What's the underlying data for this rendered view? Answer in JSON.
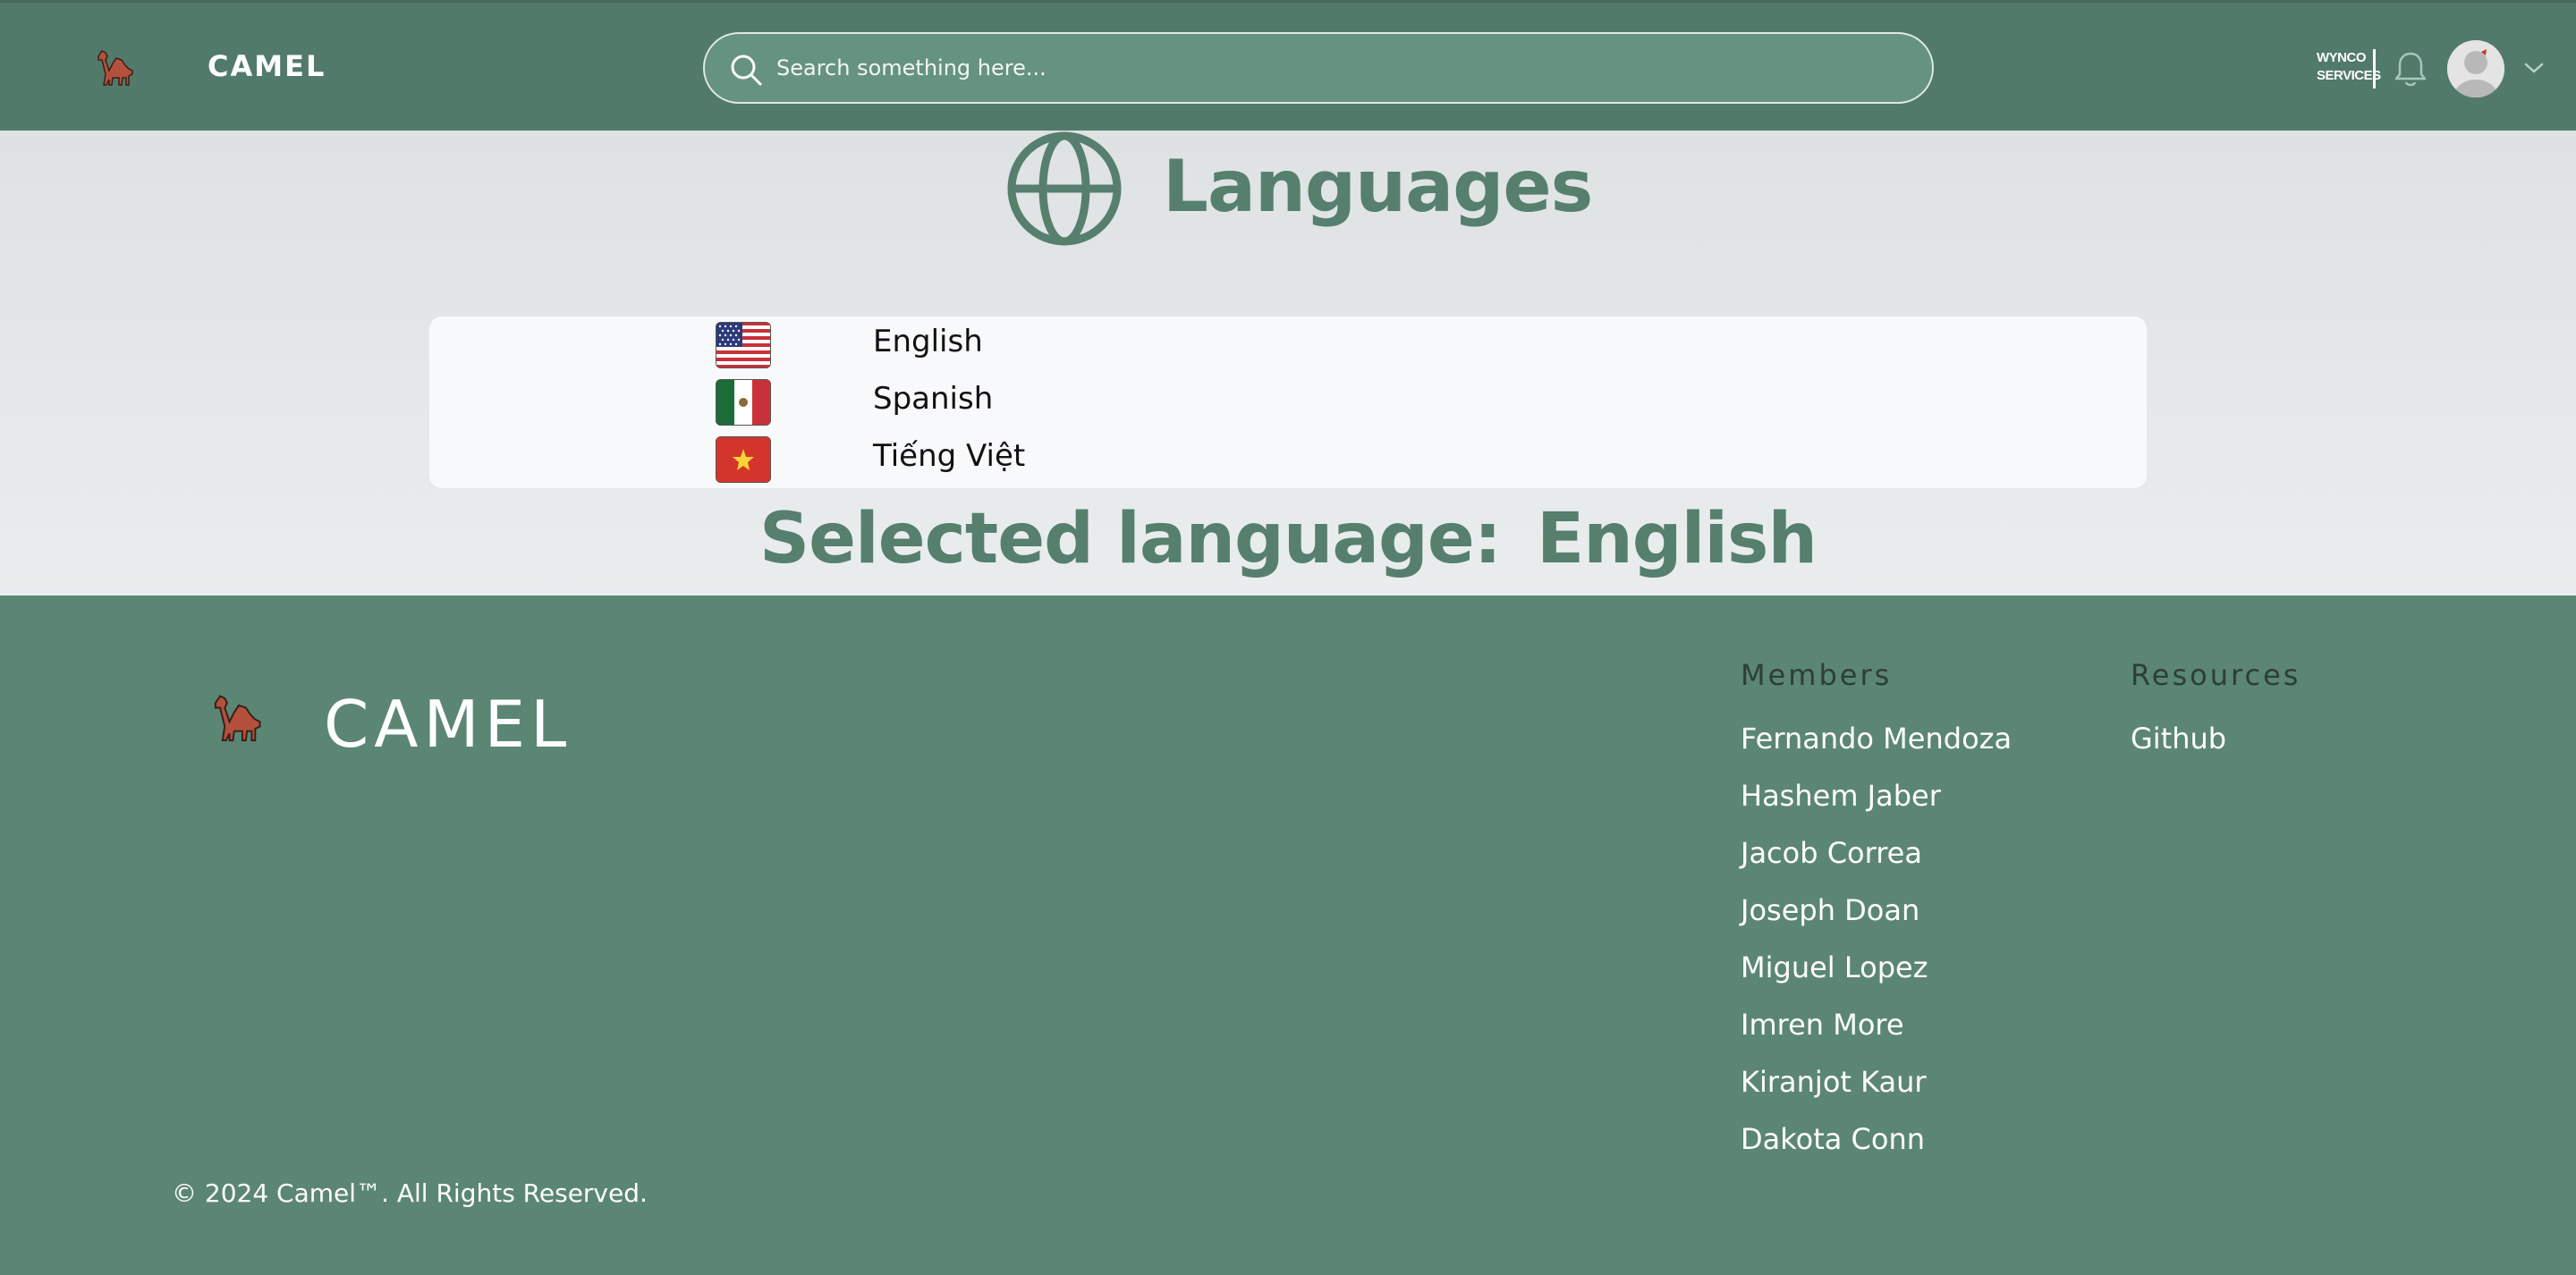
{
  "header": {
    "app_name": "CAMEL",
    "search_placeholder": "Search something here...",
    "partner_logo": "WYNCO SERVICES"
  },
  "main": {
    "title": "Languages",
    "languages": [
      {
        "label": "English",
        "flag": "us-flag-icon"
      },
      {
        "label": "Spanish",
        "flag": "mexico-flag-icon"
      },
      {
        "label": "Tiếng Việt",
        "flag": "vietnam-flag-icon"
      }
    ],
    "selected_label": "Selected language:",
    "selected_value": "English"
  },
  "footer": {
    "brand": "CAMEL",
    "members_heading": "Members",
    "members": [
      "Fernando Mendoza",
      "Hashem Jaber",
      "Jacob Correa",
      "Joseph Doan",
      "Miguel Lopez",
      "Imren More",
      "Kiranjot Kaur",
      "Dakota Conn"
    ],
    "resources_heading": "Resources",
    "resources": [
      "Github"
    ],
    "copyright": "© 2024 Camel™. All Rights Reserved."
  },
  "colors": {
    "header_bg": "#527a6b",
    "footer_bg": "#5b8674",
    "accent": "#567f6e",
    "camel": "#b3513c"
  }
}
